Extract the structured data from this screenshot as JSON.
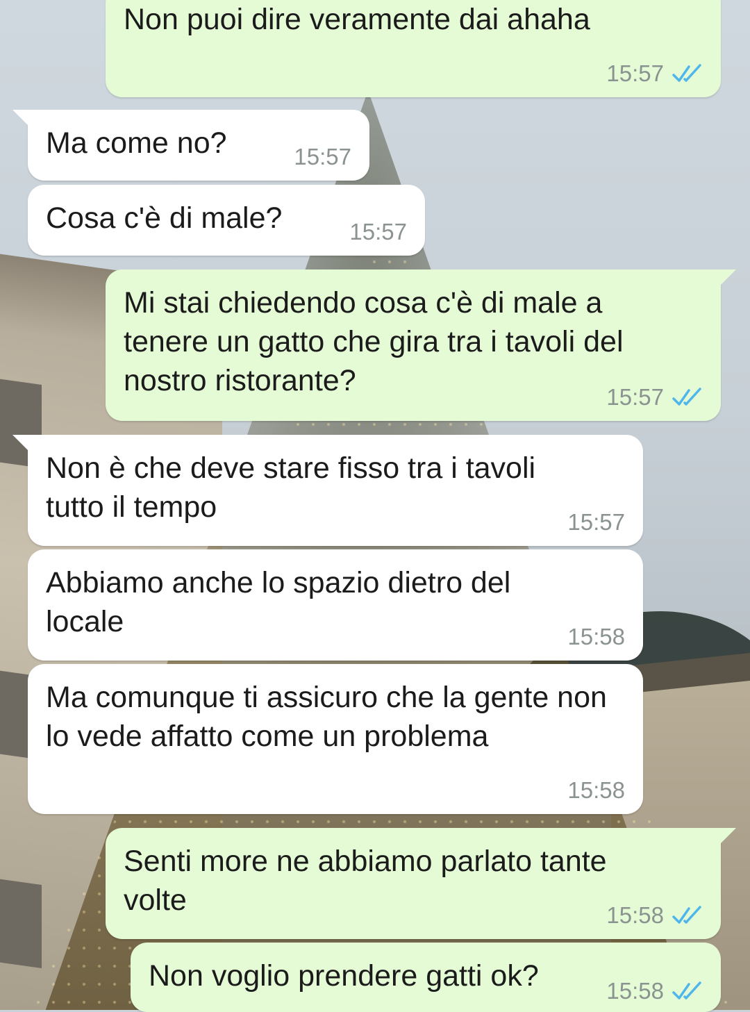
{
  "messages": [
    {
      "id": "m1",
      "direction": "out",
      "text": "Non puoi dire veramente dai ahaha",
      "time": "15:57",
      "status": "read"
    },
    {
      "id": "m2",
      "direction": "in",
      "text": "Ma come no?",
      "time": "15:57"
    },
    {
      "id": "m3",
      "direction": "in",
      "text": "Cosa c'è di male?",
      "time": "15:57"
    },
    {
      "id": "m4",
      "direction": "out",
      "text": "Mi stai chiedendo cosa c'è di male a tenere un gatto che gira tra i tavoli del nostro ristorante?",
      "time": "15:57",
      "status": "read"
    },
    {
      "id": "m5",
      "direction": "in",
      "text": "Non è che deve stare fisso tra i tavoli tutto il tempo",
      "time": "15:57"
    },
    {
      "id": "m6",
      "direction": "in",
      "text": "Abbiamo anche lo spazio dietro del locale",
      "time": "15:58"
    },
    {
      "id": "m7",
      "direction": "in",
      "text": "Ma comunque ti assicuro che la gente non lo vede affatto come un problema",
      "time": "15:58"
    },
    {
      "id": "m8",
      "direction": "out",
      "text": "Senti more ne abbiamo parlato tante volte",
      "time": "15:58",
      "status": "read"
    },
    {
      "id": "m9",
      "direction": "out",
      "text": "Non voglio prendere gatti ok?",
      "time": "15:58",
      "status": "read"
    }
  ],
  "colors": {
    "incoming_bubble": "#ffffff",
    "outgoing_bubble": "#e4fbd6",
    "text": "#1b1b1b",
    "timestamp": "#8a938f",
    "read_ticks": "#4fb6ec"
  },
  "icons": {
    "read_receipt": "double-check-icon"
  }
}
